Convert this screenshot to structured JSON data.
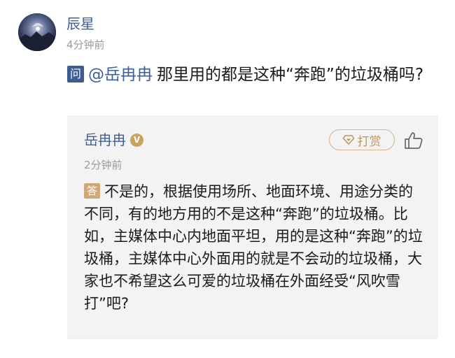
{
  "post": {
    "author": "辰星",
    "time": "4分钟前",
    "question_tag": "问",
    "mention": "@岳冉冉",
    "question_text": "那里用的都是这种“奔跑”的垃圾桶吗?"
  },
  "reply": {
    "author": "岳冉冉",
    "verified_badge": "V",
    "tip_label": "打赏",
    "time": "2分钟前",
    "answer_tag": "答",
    "answer_text": "不是的，根据使用场所、地面环境、用途分类的不同，有的地方用的不是这种“奔跑”的垃圾桶。比如，主媒体中心内地面平坦，用的是这种“奔跑”的垃圾桶，主媒体中心外面用的就是不会动的垃圾桶，大家也不希望这么可爱的垃圾桶在外面经受“风吹雪打”吧?"
  },
  "icons": {
    "tip": "diamond-tip-icon",
    "like": "thumbs-up-icon",
    "verified": "verified-badge-icon"
  },
  "colors": {
    "link_blue": "#3e5f96",
    "question_tag_bg": "#3d5d92",
    "answer_tag_bg": "#d0a77a",
    "tip_gold": "#c09560",
    "reply_bg": "#f3f3f4",
    "meta_gray": "#9a9a9a"
  }
}
